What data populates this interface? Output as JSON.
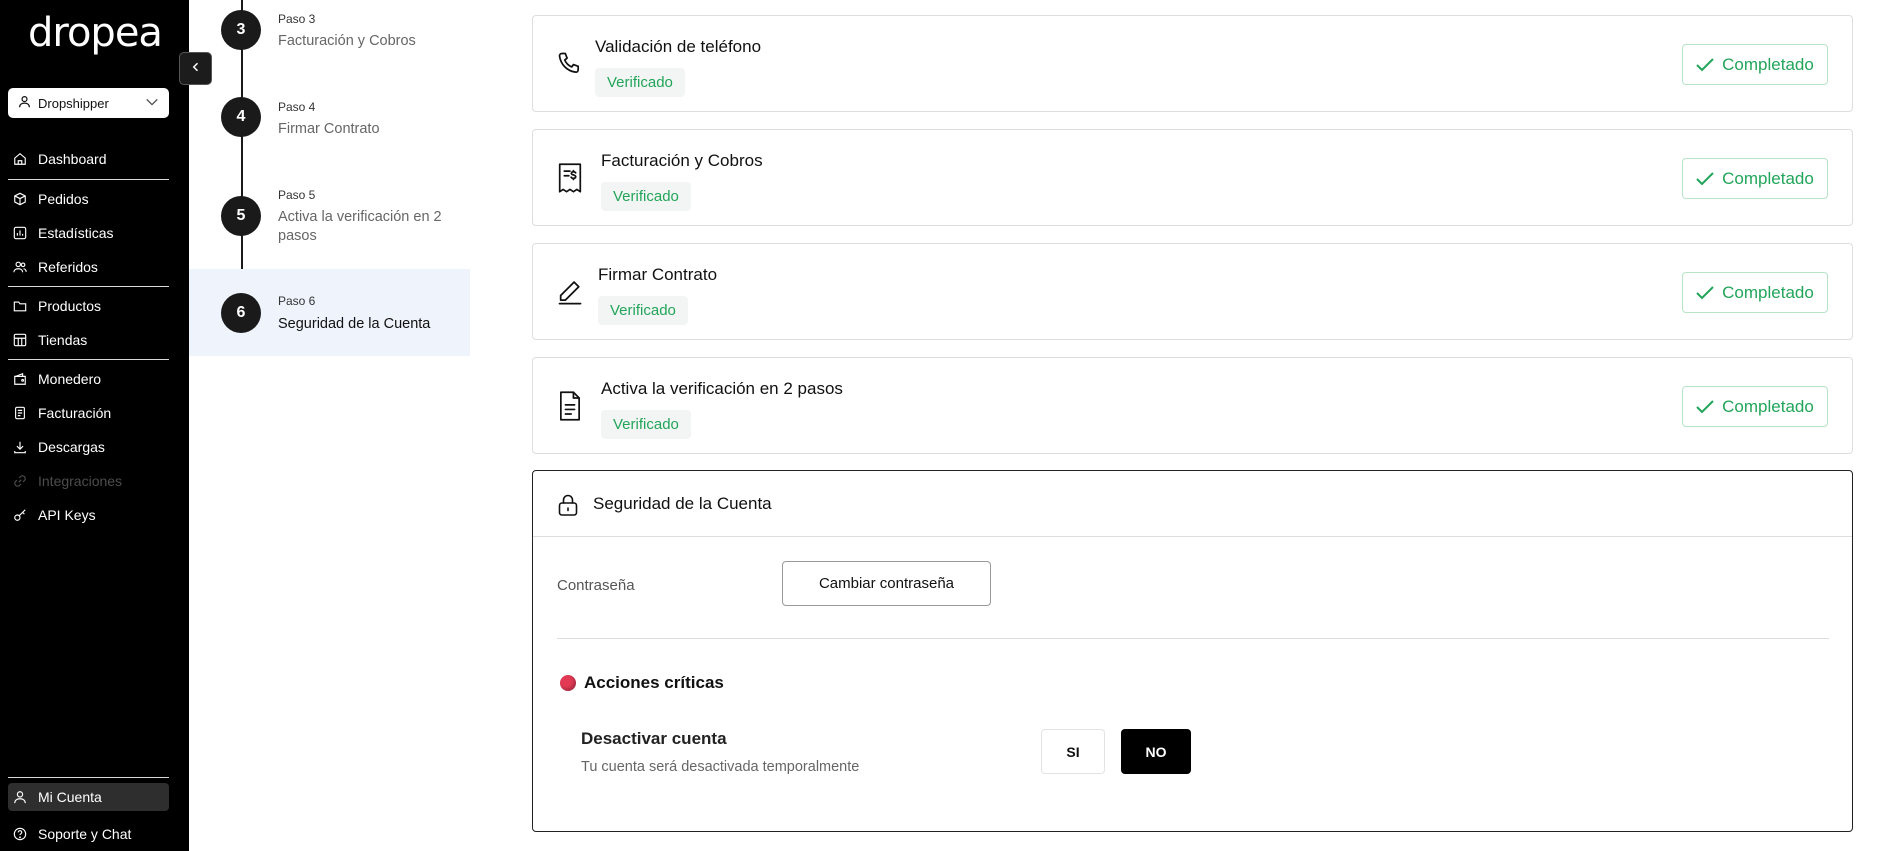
{
  "brand": {
    "logo_text": "dropea"
  },
  "sidebar": {
    "role_selector": {
      "value": "Dropshipper"
    },
    "items": [
      {
        "label": "Dashboard",
        "icon": "home-icon"
      },
      {
        "label": "Pedidos",
        "icon": "box-icon"
      },
      {
        "label": "Estadísticas",
        "icon": "chart-icon"
      },
      {
        "label": "Referidos",
        "icon": "users-icon"
      },
      {
        "label": "Productos",
        "icon": "folder-icon"
      },
      {
        "label": "Tiendas",
        "icon": "store-icon"
      },
      {
        "label": "Monedero",
        "icon": "wallet-icon"
      },
      {
        "label": "Facturación",
        "icon": "invoice-icon"
      },
      {
        "label": "Descargas",
        "icon": "download-icon"
      },
      {
        "label": "Integraciones",
        "icon": "link-icon",
        "disabled": true
      },
      {
        "label": "API Keys",
        "icon": "key-icon"
      }
    ],
    "bottom": [
      {
        "label": "Mi Cuenta",
        "icon": "user-icon",
        "active": true
      },
      {
        "label": "Soporte y Chat",
        "icon": "help-icon"
      }
    ]
  },
  "steps": [
    {
      "number": "3",
      "small": "Paso 3",
      "title": "Facturación y Cobros"
    },
    {
      "number": "4",
      "small": "Paso 4",
      "title": "Firmar Contrato"
    },
    {
      "number": "5",
      "small": "Paso 5",
      "title": "Activa la verificación en 2 pasos"
    },
    {
      "number": "6",
      "small": "Paso 6",
      "title": "Seguridad de la Cuenta",
      "active": true
    }
  ],
  "cards": [
    {
      "title": "Validación de teléfono",
      "badge": "Verificado",
      "status": "Completado",
      "icon": "phone-icon"
    },
    {
      "title": "Facturación y Cobros",
      "badge": "Verificado",
      "status": "Completado",
      "icon": "receipt-icon"
    },
    {
      "title": "Firmar Contrato",
      "badge": "Verificado",
      "status": "Completado",
      "icon": "pen-icon"
    },
    {
      "title": "Activa la verificación en 2 pasos",
      "badge": "Verificado",
      "status": "Completado",
      "icon": "document-icon"
    }
  ],
  "security": {
    "title": "Seguridad de la Cuenta",
    "password_label": "Contraseña",
    "change_password_button": "Cambiar contraseña",
    "critical_title": "Acciones críticas",
    "deactivate_title": "Desactivar cuenta",
    "deactivate_desc": "Tu cuenta será desactivada temporalmente",
    "yes_button": "SI",
    "no_button": "NO"
  },
  "colors": {
    "accent_green": "#22a55a",
    "critical_red": "#e23a55",
    "active_step_bg": "#eef3fc"
  }
}
